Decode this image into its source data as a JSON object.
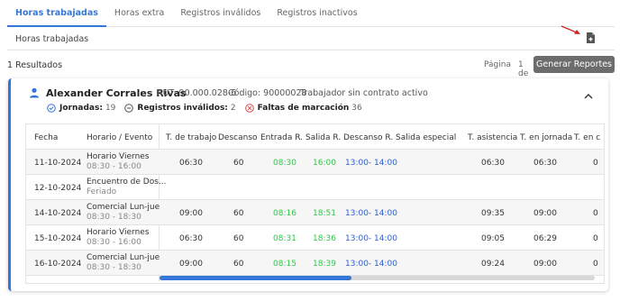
{
  "tabs": [
    "Horas trabajadas",
    "Horas extra",
    "Registros inválidos",
    "Registros inactivos"
  ],
  "subheader": {
    "title": "Horas trabajadas"
  },
  "results_label": "1 Resultados",
  "pagination": {
    "label": "Página",
    "of_label": "1 de"
  },
  "generate_button": "Generar Reportes",
  "employee": {
    "name": "Alexander Corrales Rivas",
    "rut": "RUT: 90.000.028-6",
    "code": "Código: 90000028",
    "contract": "Trabajador sin contrato activo"
  },
  "stats": {
    "jornadas_label": "Jornadas:",
    "jornadas_value": "19",
    "invalidos_label": "Registros inválidos:",
    "invalidos_value": "2",
    "faltas_label": "Faltas de marcación",
    "faltas_value": "36"
  },
  "colors": {
    "accent": "#3577d8",
    "green": "#2fc74b",
    "blue": "#2c5fd1",
    "danger": "#e04848",
    "button": "#6c6c6c"
  },
  "table": {
    "headers": [
      "Fecha",
      "Horario / Evento",
      "T. de trabajo",
      "Descanso",
      "Entrada R.",
      "Salida R.",
      "Descanso R.",
      "Salida especial",
      "T. asistencia",
      "T. en jornada",
      "T. en c"
    ],
    "rows": [
      {
        "fecha": "11-10-2024",
        "horario": "Horario Viernes",
        "horario_sub": "08:30 - 16:00",
        "trabajo": "06:30",
        "descanso": "60",
        "entrada": "08:30",
        "salida": "16:00",
        "descanso_r": "13:00- 14:00",
        "asistencia": "06:30",
        "jornada": "06:30",
        "extra": "0"
      },
      {
        "fecha": "12-10-2024",
        "horario": "Encuentro de Dos...",
        "horario_sub": "Feriado",
        "trabajo": "",
        "descanso": "",
        "entrada": "",
        "salida": "",
        "descanso_r": "",
        "asistencia": "",
        "jornada": "",
        "extra": ""
      },
      {
        "fecha": "14-10-2024",
        "horario": "Comercial Lun-jue",
        "horario_sub": "08:30 - 18:30",
        "trabajo": "09:00",
        "descanso": "60",
        "entrada": "08:16",
        "salida": "18:51",
        "descanso_r": "13:00- 14:00",
        "asistencia": "09:35",
        "jornada": "09:00",
        "extra": "0"
      },
      {
        "fecha": "15-10-2024",
        "horario": "Horario Viernes",
        "horario_sub": "08:30 - 16:00",
        "trabajo": "06:30",
        "descanso": "60",
        "entrada": "08:31",
        "salida": "18:36",
        "descanso_r": "13:00- 14:00",
        "asistencia": "09:05",
        "jornada": "06:29",
        "extra": "0"
      },
      {
        "fecha": "16-10-2024",
        "horario": "Comercial Lun-jue",
        "horario_sub": "08:30 - 18:30",
        "trabajo": "09:00",
        "descanso": "60",
        "entrada": "08:15",
        "salida": "18:39",
        "descanso_r": "13:00- 14:00",
        "asistencia": "09:24",
        "jornada": "09:00",
        "extra": "0"
      }
    ]
  }
}
